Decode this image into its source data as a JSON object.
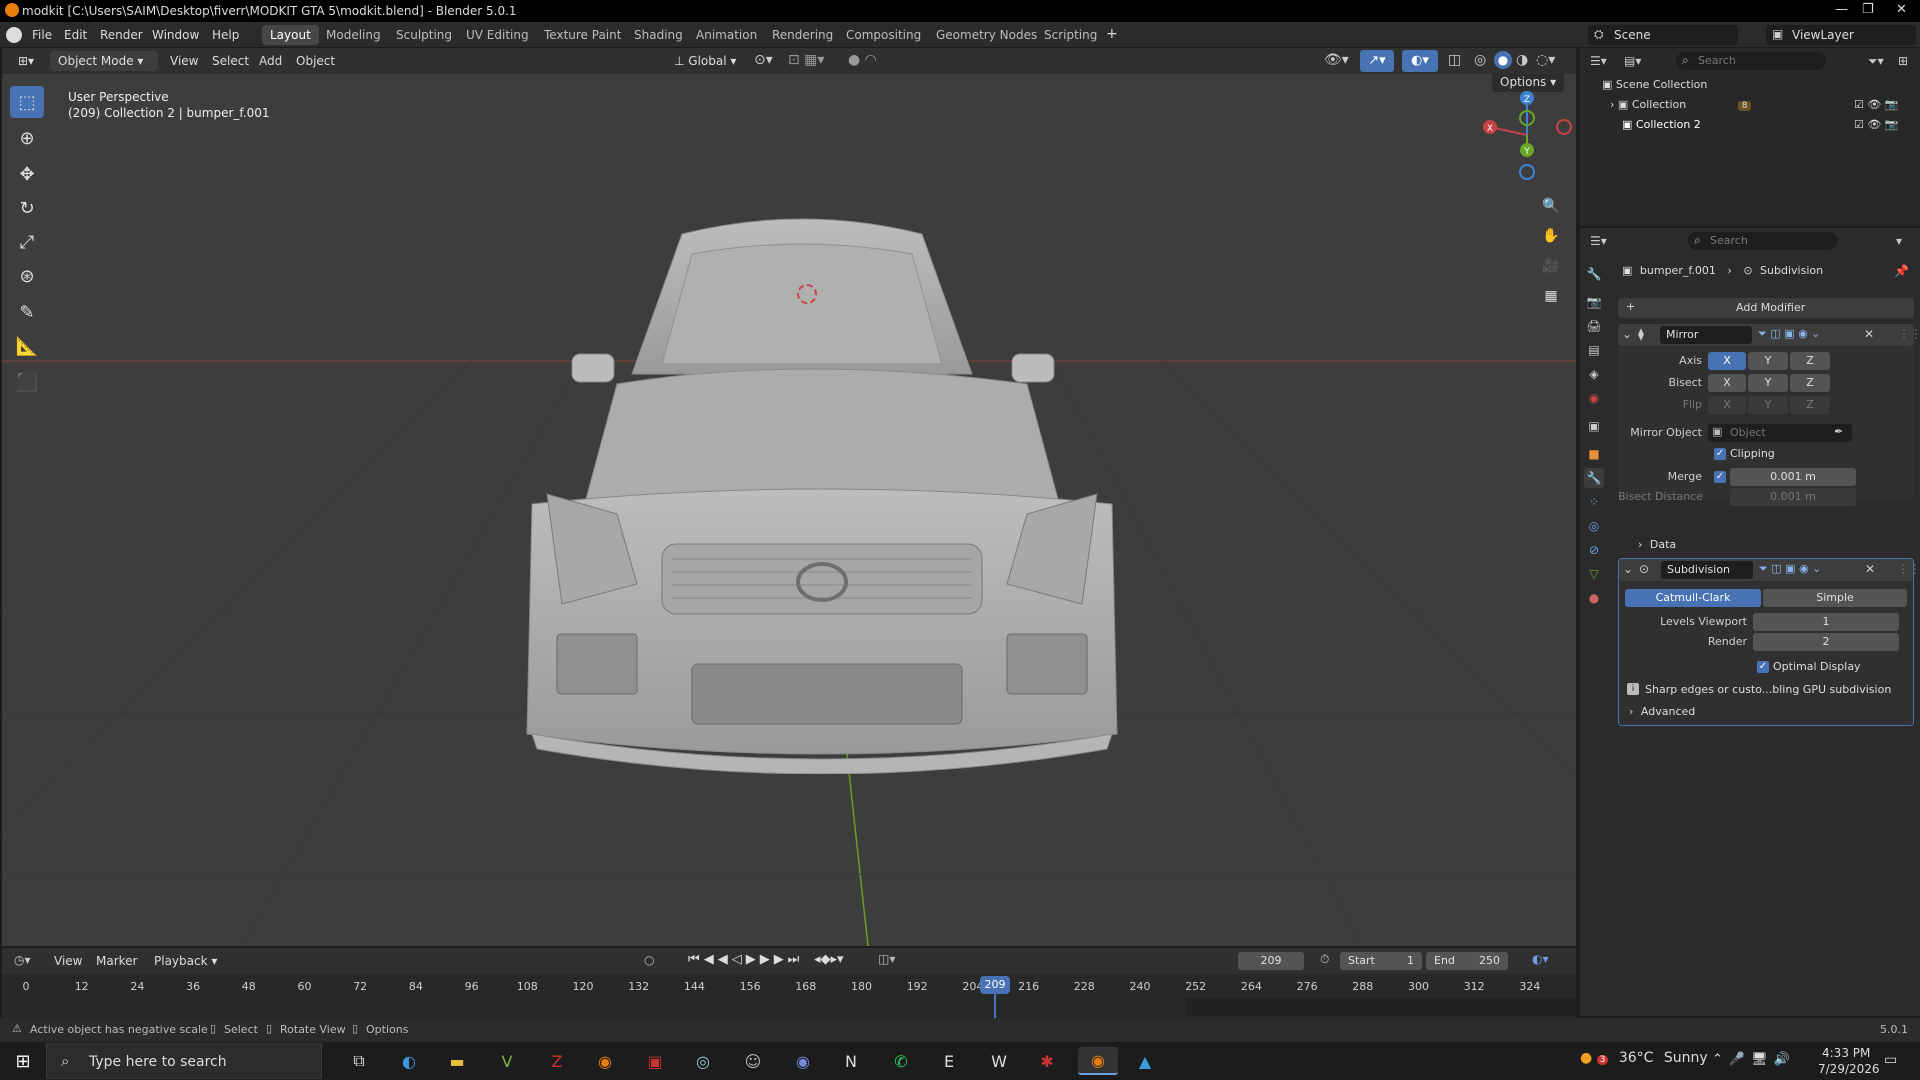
{
  "window": {
    "title": "modkit [C:\\Users\\SAIM\\Desktop\\fiverr\\MODKIT GTA 5\\modkit.blend] - Blender 5.0.1",
    "minimize": "—",
    "maximize": "❐",
    "close": "✕"
  },
  "menu": {
    "file": "File",
    "edit": "Edit",
    "render": "Render",
    "window": "Window",
    "help": "Help"
  },
  "workspaces": [
    "Layout",
    "Modeling",
    "Sculpting",
    "UV Editing",
    "Texture Paint",
    "Shading",
    "Animation",
    "Rendering",
    "Compositing",
    "Geometry Nodes",
    "Scripting"
  ],
  "workspace_add": "+",
  "scene": {
    "label": "Scene",
    "viewlayer": "ViewLayer"
  },
  "viewport_header": {
    "mode": "Object Mode",
    "view": "View",
    "select": "Select",
    "add": "Add",
    "object": "Object",
    "transform_orientation": "Global",
    "options": "Options"
  },
  "viewport": {
    "perspective": "User Perspective",
    "object_info": "(209) Collection 2 | bumper_f.001",
    "gizmo": {
      "x": "X",
      "y": "Y",
      "z": "Z"
    }
  },
  "outliner": {
    "search_placeholder": "Search",
    "root": "Scene Collection",
    "items": [
      {
        "label": "Collection",
        "badge": "8"
      },
      {
        "label": "Collection 2"
      }
    ]
  },
  "properties": {
    "search_placeholder": "Search",
    "object_name": "bumper_f.001",
    "modifier_context": "Subdivision",
    "add_modifier": "Add Modifier",
    "mirror": {
      "name": "Mirror",
      "axis_label": "Axis",
      "bisect_label": "Bisect",
      "flip_label": "Flip",
      "x": "X",
      "y": "Y",
      "z": "Z",
      "mirror_object_label": "Mirror Object",
      "mirror_object_placeholder": "Object",
      "clipping_label": "Clipping",
      "merge_label": "Merge",
      "merge_value": "0.001 m",
      "bisect_distance_label": "Bisect Distance",
      "bisect_distance_value": "0.001 m",
      "data_label": "Data"
    },
    "subdivision": {
      "name": "Subdivision",
      "catmull": "Catmull-Clark",
      "simple": "Simple",
      "levels_label": "Levels Viewport",
      "levels_value": "1",
      "render_label": "Render",
      "render_value": "2",
      "optimal_label": "Optimal Display",
      "warning": "Sharp edges or custo...bling GPU subdivision",
      "advanced_label": "Advanced"
    }
  },
  "timeline": {
    "view": "View",
    "marker": "Marker",
    "playback": "Playback",
    "current_frame": "209",
    "start_label": "Start",
    "start": "1",
    "end_label": "End",
    "end": "250",
    "ticks": [
      "0",
      "12",
      "24",
      "36",
      "48",
      "60",
      "72",
      "84",
      "96",
      "108",
      "120",
      "132",
      "144",
      "156",
      "168",
      "180",
      "192",
      "204",
      "216",
      "228",
      "240",
      "252",
      "264",
      "276",
      "288",
      "300",
      "312",
      "324"
    ],
    "playhead": "209"
  },
  "statusbar": {
    "message": "Active object has negative scale",
    "select": "Select",
    "rotate": "Rotate View",
    "options": "Options",
    "version": "5.0.1"
  },
  "taskbar": {
    "search_placeholder": "Type here to search",
    "weather_temp": "36°C",
    "weather_desc": "Sunny",
    "weather_badge": "3",
    "time": "4:33 PM",
    "date": "7/29/2026"
  },
  "colors": {
    "accent": "#4772b3",
    "viewport_bg": "#3d3d3d",
    "axis_x": "#c44444",
    "axis_y": "#6aa628",
    "axis_z": "#3b83d6",
    "playhead": "#4772b3"
  }
}
